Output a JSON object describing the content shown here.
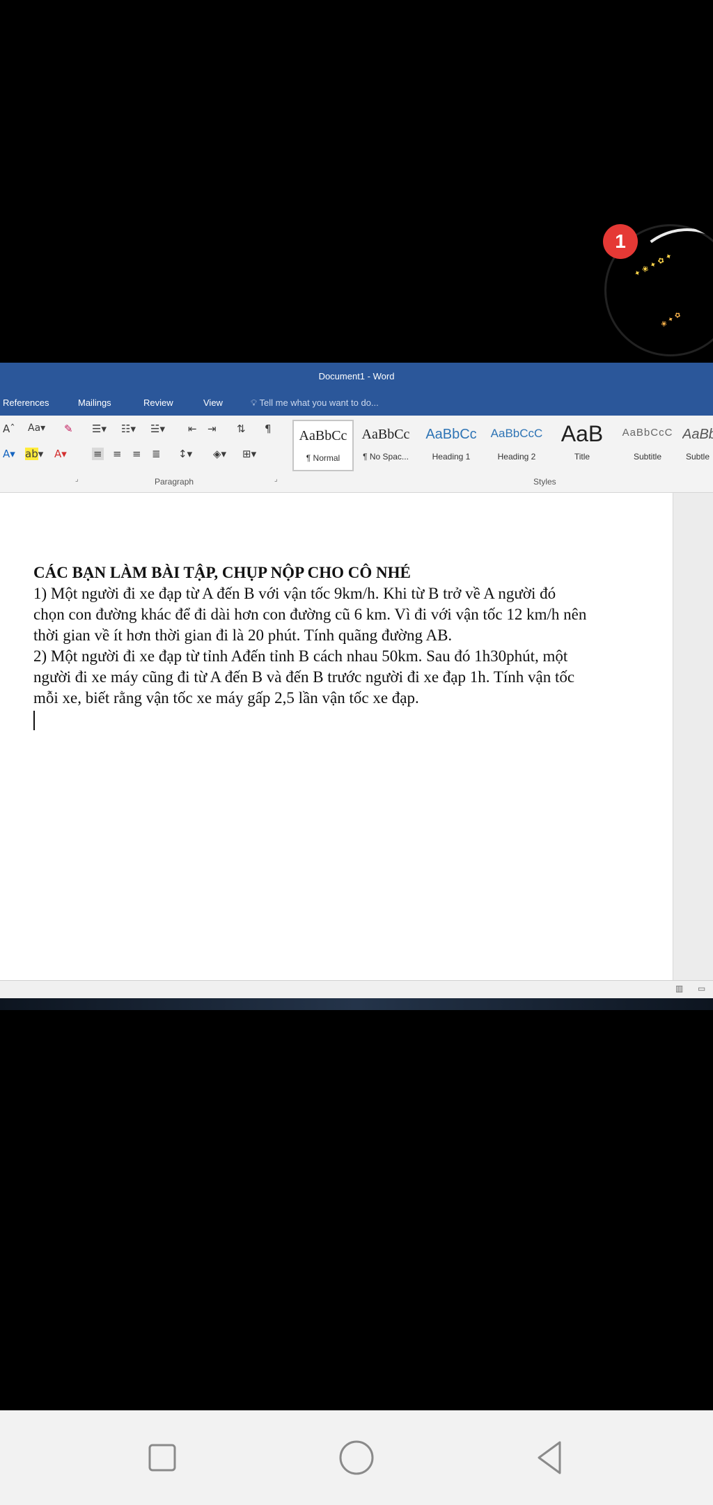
{
  "overlay": {
    "badge_count": "1"
  },
  "word": {
    "window_title": "Document1 - Word",
    "menu": [
      "References",
      "Mailings",
      "Review",
      "View"
    ],
    "tell_me_placeholder": "Tell me what you want to do...",
    "ribbon": {
      "font_size_label": "Aa",
      "group_paragraph": "Paragraph",
      "group_styles": "Styles",
      "styles": [
        {
          "sample": "AaBbCc",
          "name": "¶ Normal"
        },
        {
          "sample": "AaBbCc",
          "name": "¶ No Spac..."
        },
        {
          "sample": "AaBbCc",
          "name": "Heading 1"
        },
        {
          "sample": "AaBbCcC",
          "name": "Heading 2"
        },
        {
          "sample": "AaB",
          "name": "Title"
        },
        {
          "sample": "AaBbCcC",
          "name": "Subtitle"
        },
        {
          "sample": "AaBb",
          "name": "Subtle"
        }
      ]
    },
    "document": {
      "heading": "CÁC BẠN LÀM BÀI TẬP, CHỤP NỘP CHO CÔ NHÉ",
      "paragraphs": [
        "1) Một người đi xe đạp từ A đến B với vận tốc 9km/h. Khi từ B trở về A người đó chọn con đường khác để đi dài hơn con đường cũ 6 km. Vì đi với  vận tốc 12 km/h nên thời gian về ít hơn thời gian đi là 20 phút. Tính quãng đường AB.",
        "2) Một người đi xe đạp từ tỉnh Ađến tỉnh B cách nhau 50km. Sau đó 1h30phút, một người đi xe máy cũng đi từ A đến B và đến B trước người đi xe đạp 1h. Tính vận tốc mỗi xe, biết rằng vận tốc xe máy gấp 2,5 lần vận tốc xe đạp."
      ]
    }
  },
  "colors": {
    "word_blue": "#2b579a",
    "badge_red": "#e53935"
  }
}
